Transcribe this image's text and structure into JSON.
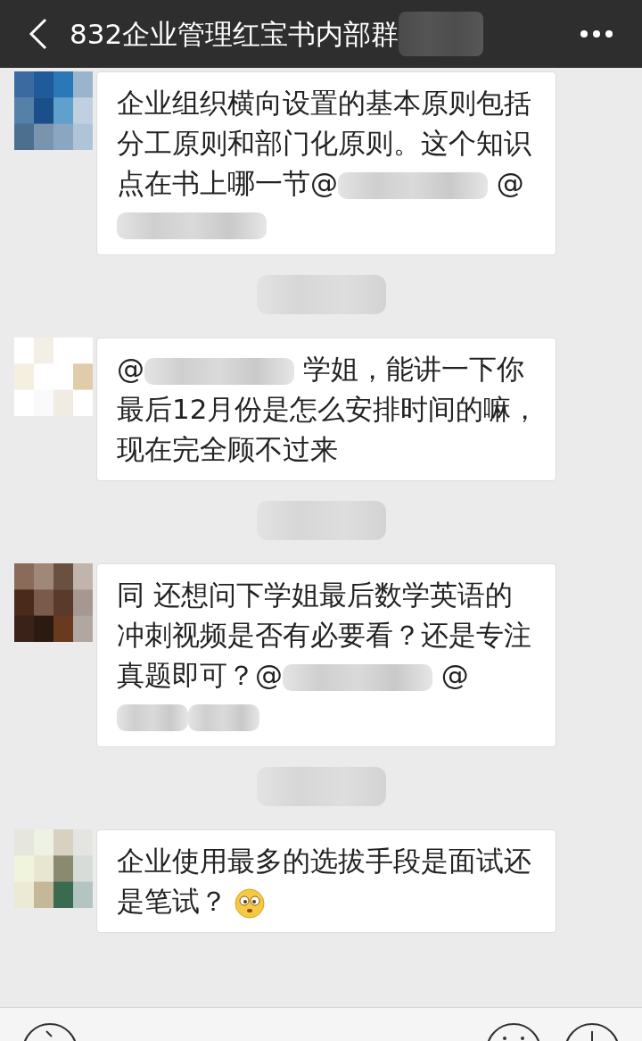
{
  "header": {
    "title": "832企业管理红宝书内部群",
    "title_redacted": true
  },
  "items": [
    {
      "kind": "message",
      "segments": [
        {
          "kind": "text",
          "text": "企业组织横向设置的基本原则包括分工原则和部门化原则。这个知识点在书上哪一节@"
        },
        {
          "kind": "redacted_long"
        },
        {
          "kind": "text",
          "text": " @"
        },
        {
          "kind": "redacted_long"
        }
      ]
    },
    {
      "kind": "time_redacted"
    },
    {
      "kind": "message",
      "segments": [
        {
          "kind": "text",
          "text": "@"
        },
        {
          "kind": "redacted_long"
        },
        {
          "kind": "text",
          "text": "  学姐，能讲一下你最后12月份是怎么安排时间的嘛，现在完全顾不过来"
        }
      ]
    },
    {
      "kind": "time_redacted"
    },
    {
      "kind": "message",
      "segments": [
        {
          "kind": "text",
          "text": "同 还想问下学姐最后数学英语的冲刺视频是否有必要看？还是专注真题即可？@"
        },
        {
          "kind": "redacted_long"
        },
        {
          "kind": "text",
          "text": " @"
        },
        {
          "kind": "redacted_short"
        },
        {
          "kind": "redacted_short"
        }
      ]
    },
    {
      "kind": "time_redacted"
    },
    {
      "kind": "message",
      "segments": [
        {
          "kind": "text",
          "text": "企业使用最多的选拔手段是面试还是笔试？"
        },
        {
          "kind": "emoji"
        }
      ]
    }
  ]
}
